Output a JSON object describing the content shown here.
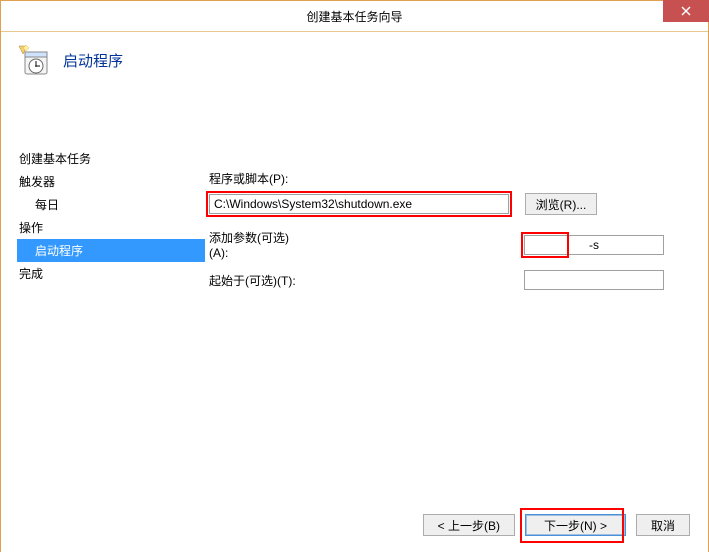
{
  "window": {
    "title": "创建基本任务向导"
  },
  "header": {
    "title": "启动程序"
  },
  "sidebar": {
    "items": [
      {
        "label": "创建基本任务",
        "sub": false,
        "selected": false
      },
      {
        "label": "触发器",
        "sub": false,
        "selected": false
      },
      {
        "label": "每日",
        "sub": true,
        "selected": false
      },
      {
        "label": "操作",
        "sub": false,
        "selected": false
      },
      {
        "label": "启动程序",
        "sub": true,
        "selected": true
      },
      {
        "label": "完成",
        "sub": false,
        "selected": false
      }
    ]
  },
  "form": {
    "program_label": "程序或脚本(P):",
    "program_value": "C:\\Windows\\System32\\shutdown.exe",
    "browse_label": "浏览(R)...",
    "args_label": "添加参数(可选)(A):",
    "args_value": "-s",
    "startin_label": "起始于(可选)(T):",
    "startin_value": ""
  },
  "footer": {
    "back": "< 上一步(B)",
    "next": "下一步(N) >",
    "cancel": "取消"
  }
}
